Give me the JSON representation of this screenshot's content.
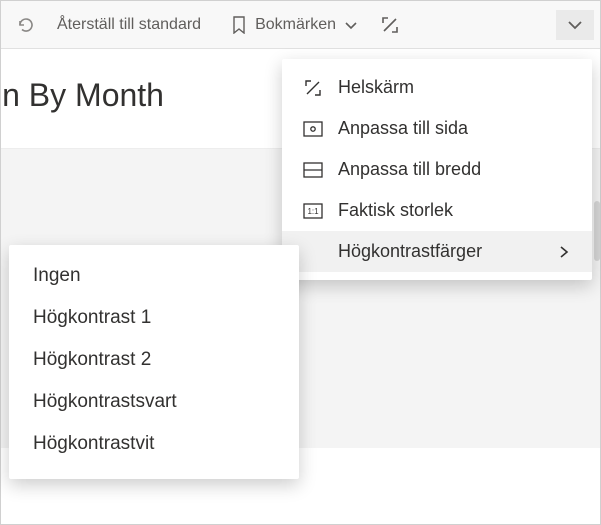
{
  "toolbar": {
    "undo_tooltip": "Undo",
    "reset_label": "Återställ till standard",
    "bookmarks_label": "Bokmärken"
  },
  "page_title": "in By Month",
  "view_menu": {
    "items": [
      {
        "label": "Helskärm",
        "icon": "fullscreen"
      },
      {
        "label": "Anpassa till sida",
        "icon": "fit-page"
      },
      {
        "label": "Anpassa till bredd",
        "icon": "fit-width"
      },
      {
        "label": "Faktisk storlek",
        "icon": "actual-size"
      },
      {
        "label": "Högkontrastfärger",
        "icon": "",
        "submenu": true,
        "hovered": true
      }
    ]
  },
  "contrast_submenu": {
    "items": [
      {
        "label": "Ingen"
      },
      {
        "label": "Högkontrast 1"
      },
      {
        "label": "Högkontrast 2"
      },
      {
        "label": "Högkontrastsvart"
      },
      {
        "label": "Högkontrastvit"
      }
    ]
  }
}
